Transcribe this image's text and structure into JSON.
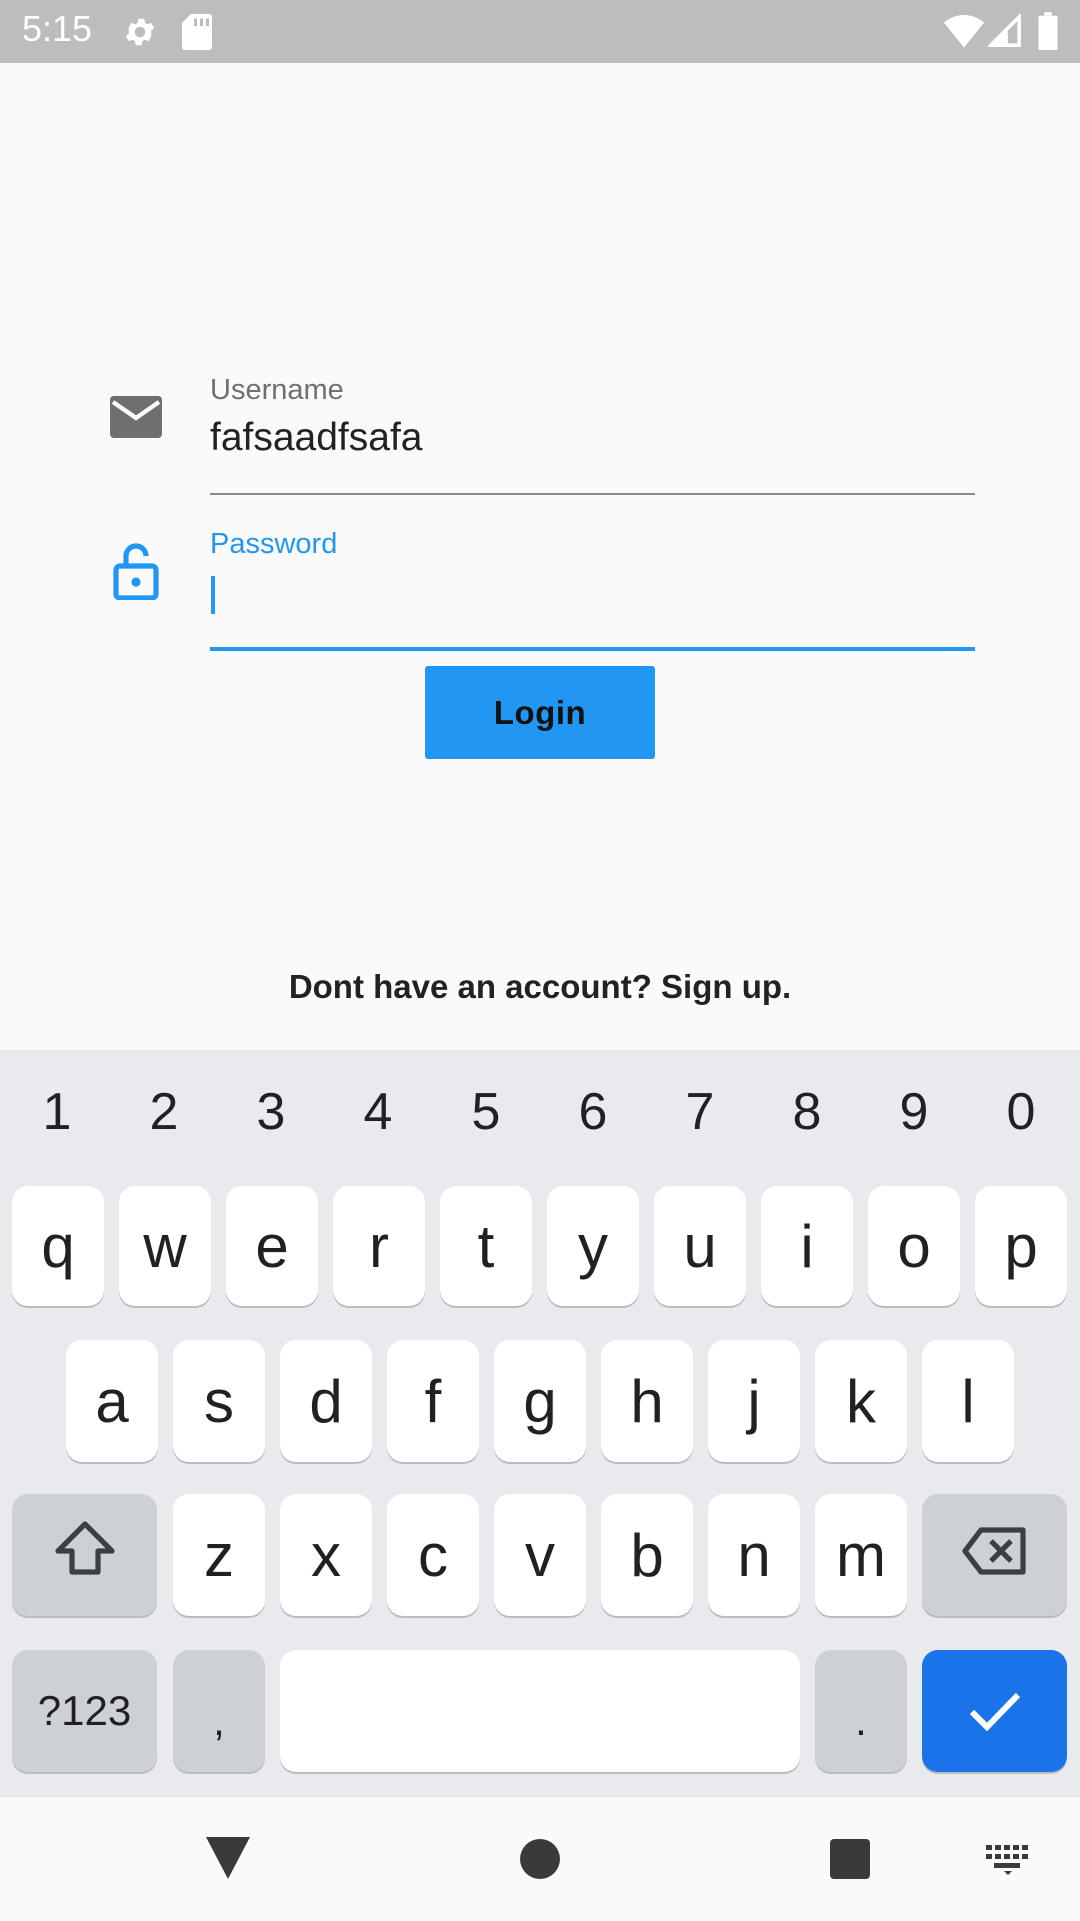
{
  "status_bar": {
    "time": "5:15",
    "icons": [
      "gear-icon",
      "sd-card-icon",
      "wifi-icon",
      "signal-icon",
      "battery-icon"
    ]
  },
  "form": {
    "username": {
      "label": "Username",
      "value": "fafsaadfsafa",
      "icon": "mail-icon"
    },
    "password": {
      "label": "Password",
      "value": "",
      "icon": "lock-icon"
    },
    "login_label": "Login",
    "signup_text": "Dont have an account? Sign up."
  },
  "keyboard": {
    "numbers": [
      "1",
      "2",
      "3",
      "4",
      "5",
      "6",
      "7",
      "8",
      "9",
      "0"
    ],
    "row1": [
      "q",
      "w",
      "e",
      "r",
      "t",
      "y",
      "u",
      "i",
      "o",
      "p"
    ],
    "row2": [
      "a",
      "s",
      "d",
      "f",
      "g",
      "h",
      "j",
      "k",
      "l"
    ],
    "row3": [
      "z",
      "x",
      "c",
      "v",
      "b",
      "n",
      "m"
    ],
    "symbols_label": "?123",
    "comma": ",",
    "period": "."
  },
  "colors": {
    "accent": "#2196f3",
    "keyboard_bg": "#e8eaed",
    "enter_key": "#1a73e8"
  }
}
